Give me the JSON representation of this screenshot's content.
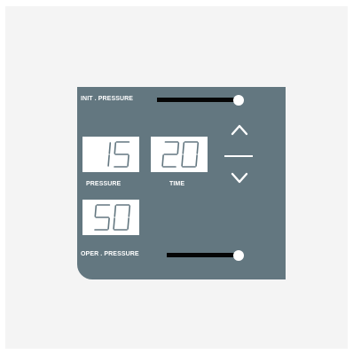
{
  "panel": {
    "init_pressure_label": "INIT . PRESSURE",
    "oper_pressure_label": "OPER . PRESSURE",
    "pressure_label": "PRESSURE",
    "time_label": "TIME",
    "pressure_display": "15",
    "time_display": "20",
    "oper_display": "50"
  },
  "icons": {
    "up": "chevron-up-icon",
    "down": "chevron-down-icon"
  },
  "colors": {
    "panel_bg": "#637780",
    "background": "#f4f4f4",
    "lcd_bg": "#ffffff",
    "segment": "#637780",
    "slider_track": "#050505",
    "text": "#ffffff"
  }
}
